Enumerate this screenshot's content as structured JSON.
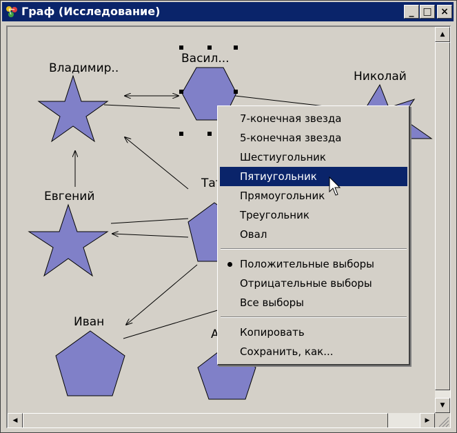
{
  "window": {
    "title": "Граф (Исследование)",
    "buttons": {
      "minimize": "_",
      "maximize": "□",
      "close": "×"
    }
  },
  "graph": {
    "nodes": [
      {
        "label": "Владимир..",
        "shape": "5-point-star",
        "selected": false
      },
      {
        "label": "Васил...",
        "shape": "hexagon",
        "selected": true
      },
      {
        "label": "Николай",
        "shape": "7-point-star",
        "selected": false
      },
      {
        "label": "Евгений",
        "shape": "5-point-star",
        "selected": false
      },
      {
        "label": "Тат",
        "shape": "pentagon",
        "selected": false
      },
      {
        "label": "Иван",
        "shape": "pentagon",
        "selected": false
      },
      {
        "label": "А",
        "shape": "pentagon",
        "selected": false
      }
    ],
    "colors": {
      "fill": "#8080c8",
      "stroke": "#000000",
      "background": "#d4d0c8"
    }
  },
  "context_menu": {
    "shape_items": [
      "7-конечная звезда",
      "5-конечная звезда",
      "Шестиугольник",
      "Пятиугольник",
      "Прямоугольник",
      "Треугольник",
      "Овал"
    ],
    "highlighted": "Пятиугольник",
    "choice_items": [
      "Положительные выборы",
      "Отрицательные выборы",
      "Все выборы"
    ],
    "checked": "Положительные выборы",
    "action_items": [
      "Копировать",
      "Сохранить, как..."
    ],
    "highlight_color": "#0a246a"
  },
  "scrollbars": {
    "vertical": true,
    "horizontal": true
  }
}
